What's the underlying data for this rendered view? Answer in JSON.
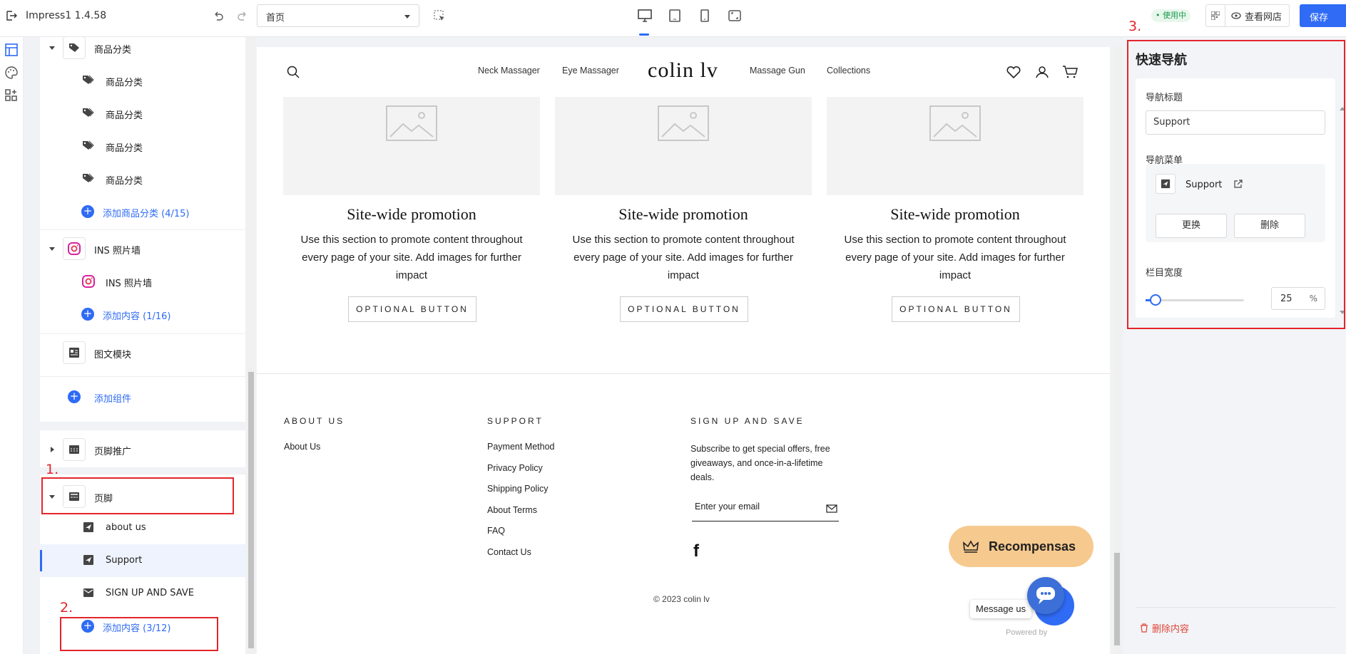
{
  "app": {
    "title": "Impress1 1.4.58",
    "page_select": "首页",
    "status_badge": "使用中",
    "view_store": "查看网店",
    "save": "保存"
  },
  "tree": {
    "category_section": "商品分类",
    "category_items": [
      "商品分类",
      "商品分类",
      "商品分类",
      "商品分类"
    ],
    "add_category": "添加商品分类 (4/15)",
    "ins_section": "INS 照片墙",
    "ins_item": "INS 照片墙",
    "ins_add": "添加内容 (1/16)",
    "image_text": "图文模块",
    "add_component": "添加组件",
    "footer_promo": "页脚推广",
    "footer": "页脚",
    "footer_items": [
      "about us",
      "Support",
      "SIGN UP AND SAVE"
    ],
    "footer_add": "添加内容 (3/12)"
  },
  "annotations": {
    "n1": "1.",
    "n2": "2.",
    "n3": "3."
  },
  "store": {
    "nav": [
      "Neck Massager",
      "Eye Massager",
      "Massage Gun",
      "Collections"
    ],
    "logo": "colin lv",
    "promo": [
      {
        "title": "Site-wide promotion",
        "text": "Use this section to promote content throughout every page of your site. Add images for further impact",
        "button": "OPTIONAL BUTTON"
      },
      {
        "title": "Site-wide promotion",
        "text": "Use this section to promote content throughout every page of your site. Add images for further impact",
        "button": "OPTIONAL BUTTON"
      },
      {
        "title": "Site-wide promotion",
        "text": "Use this section to promote content throughout every page of your site. Add images for further impact",
        "button": "OPTIONAL BUTTON"
      }
    ],
    "footer": {
      "about_heading": "ABOUT US",
      "about_links": [
        "About Us"
      ],
      "support_heading": "SUPPORT",
      "support_links": [
        "Payment Method",
        "Privacy Policy",
        "Shipping Policy",
        "About Terms",
        "FAQ",
        "Contact Us"
      ],
      "signup_heading": "SIGN UP AND SAVE",
      "signup_text": "Subscribe to get special offers, free giveaways, and once-in-a-lifetime deals.",
      "email_placeholder": "Enter your email",
      "copyright": "© 2023 colin lv"
    },
    "rewards": "Recompensas",
    "message_us": "Message us",
    "powered": "Powered by"
  },
  "panel": {
    "title": "快速导航",
    "nav_title_label": "导航标题",
    "nav_title_value": "Support",
    "nav_menu_label": "导航菜单",
    "menu_item": "Support",
    "replace": "更换",
    "delete": "删除",
    "width_label": "栏目宽度",
    "width_value": "25",
    "width_unit": "%",
    "width_fraction": 0.1,
    "delete_content": "删除内容"
  }
}
